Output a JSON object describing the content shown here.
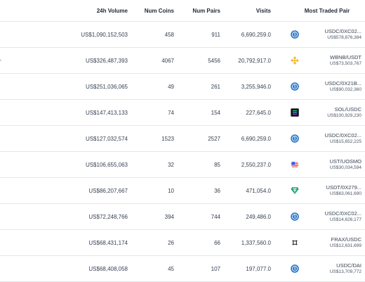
{
  "header": {
    "volume": "24h Volume",
    "coins": "Num Coins",
    "pairs": "Num Pairs",
    "visits": "Visits",
    "most_traded": "Most Traded Pair"
  },
  "rows": [
    {
      "volume": "US$1,090,152,503",
      "coins": "458",
      "pairs": "911",
      "visits": "6,690,259.0",
      "pair_name": "USDC/0XC02...",
      "pair_volume": "US$578,876,384",
      "icon": "usdc-icon",
      "show_stub": false
    },
    {
      "volume": "US$326,487,393",
      "coins": "4067",
      "pairs": "5456",
      "visits": "20,792,917.0",
      "pair_name": "WBNB/USDT",
      "pair_volume": "US$73,503,767",
      "icon": "bnb-icon",
      "show_stub": true
    },
    {
      "volume": "US$251,036,065",
      "coins": "49",
      "pairs": "261",
      "visits": "3,255,946.0",
      "pair_name": "USDC/0X21B...",
      "pair_volume": "US$90,032,360",
      "icon": "usdc-icon",
      "show_stub": false
    },
    {
      "volume": "US$147,413,133",
      "coins": "74",
      "pairs": "154",
      "visits": "227,645.0",
      "pair_name": "SOL/USDC",
      "pair_volume": "US$100,929,230",
      "icon": "sol-icon",
      "show_stub": false
    },
    {
      "volume": "US$127,032,574",
      "coins": "1523",
      "pairs": "2527",
      "visits": "6,690,259.0",
      "pair_name": "USDC/0XC02...",
      "pair_volume": "US$15,652,225",
      "icon": "usdc-icon",
      "show_stub": false
    },
    {
      "volume": "US$106,655,063",
      "coins": "32",
      "pairs": "85",
      "visits": "2,550,237.0",
      "pair_name": "UST/UOSMO",
      "pair_volume": "US$30,034,594",
      "icon": "ust-icon",
      "show_stub": false
    },
    {
      "volume": "US$86,207,667",
      "coins": "10",
      "pairs": "36",
      "visits": "471,054.0",
      "pair_name": "USDT/0X279...",
      "pair_volume": "US$63,061,690",
      "icon": "usdt-icon",
      "show_stub": false
    },
    {
      "volume": "US$72,248,766",
      "coins": "394",
      "pairs": "744",
      "visits": "249,486.0",
      "pair_name": "USDC/0XC02...",
      "pair_volume": "US$14,626,177",
      "icon": "usdc-icon",
      "show_stub": false
    },
    {
      "volume": "US$68,431,174",
      "coins": "26",
      "pairs": "66",
      "visits": "1,337,560.0",
      "pair_name": "FRAX/USDC",
      "pair_volume": "US$12,631,699",
      "icon": "frax-icon",
      "show_stub": false
    },
    {
      "volume": "US$68,408,058",
      "coins": "45",
      "pairs": "107",
      "visits": "197,077.0",
      "pair_name": "USDC/DAI",
      "pair_volume": "US$13,709,772",
      "icon": "usdc-icon",
      "show_stub": false
    }
  ],
  "colors": {
    "usdc": "#2775ca",
    "bnb": "#f3ba2f",
    "tether": "#26a17b",
    "border": "#e5e7eb"
  }
}
